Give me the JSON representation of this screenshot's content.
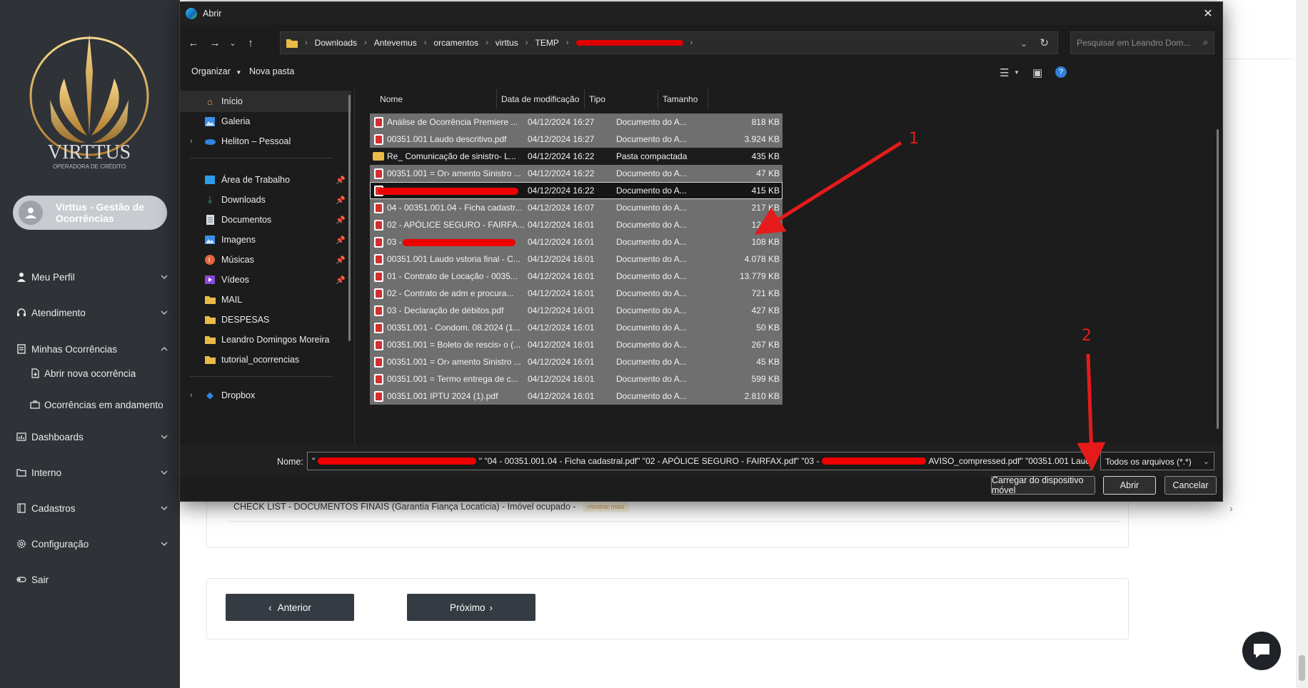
{
  "sidebar": {
    "logo_text": "VIRTTUS",
    "logo_sub": "OPERADORA DE CRÉDITO",
    "user_name": "Virttus - Gestão de Ocorrências",
    "menu": [
      {
        "label": "Meu Perfil",
        "icon": "user-icon"
      },
      {
        "label": "Atendimento",
        "icon": "headset-icon"
      },
      {
        "label": "Minhas Ocorrências",
        "icon": "list-icon"
      },
      {
        "label": "Dashboards",
        "icon": "dashboard-icon"
      },
      {
        "label": "Interno",
        "icon": "folder-icon"
      },
      {
        "label": "Cadastros",
        "icon": "book-icon"
      },
      {
        "label": "Configuração",
        "icon": "gear-icon"
      },
      {
        "label": "Sair",
        "icon": "toggle-icon"
      }
    ],
    "submenu": [
      {
        "label": "Abrir nova ocorrência",
        "icon": "new-file-icon"
      },
      {
        "label": "Ocorrências em andamento",
        "icon": "briefcase-icon"
      }
    ]
  },
  "main": {
    "checklist_label": "CHECK LIST - DOCUMENTOS FINAIS (Garantia Fiança Locatícia) - Imóvel ocupado -",
    "show_more": "mostrar mais",
    "prev_label": "Anterior",
    "next_label": "Próximo"
  },
  "dialog": {
    "title": "Abrir",
    "breadcrumb": [
      "Downloads",
      "Antevemus",
      "orcamentos",
      "virttus",
      "TEMP"
    ],
    "search_placeholder": "Pesquisar em Leandro Dom...",
    "toolbar": {
      "organize": "Organizar",
      "new_folder": "Nova pasta"
    },
    "nav_pane": [
      {
        "label": "Início",
        "icon": "home-icon"
      },
      {
        "label": "Galeria",
        "icon": "gallery-icon"
      },
      {
        "label": "Heliton – Pessoal",
        "icon": "cloud-icon"
      },
      {
        "label": "Área de Trabalho",
        "icon": "desktop-icon"
      },
      {
        "label": "Downloads",
        "icon": "download-icon"
      },
      {
        "label": "Documentos",
        "icon": "document-icon"
      },
      {
        "label": "Imagens",
        "icon": "image-icon"
      },
      {
        "label": "Músicas",
        "icon": "music-icon"
      },
      {
        "label": "Vídeos",
        "icon": "video-icon"
      },
      {
        "label": "MAIL",
        "icon": "folder-icon"
      },
      {
        "label": "DESPESAS",
        "icon": "folder-icon"
      },
      {
        "label": "Leandro Domingos Moreira",
        "icon": "folder-icon"
      },
      {
        "label": "tutorial_ocorrencias",
        "icon": "folder-icon"
      },
      {
        "label": "Dropbox",
        "icon": "dropbox-icon"
      }
    ],
    "columns": {
      "name": "Nome",
      "date": "Data de modificação",
      "type": "Tipo",
      "size": "Tamanho"
    },
    "files": [
      {
        "name": "Análise de Ocorrência Premiere ...",
        "date": "04/12/2024 16:27",
        "type": "Documento do A...",
        "size": "818 KB"
      },
      {
        "name": "00351.001 Laudo descritivo.pdf",
        "date": "04/12/2024 16:27",
        "type": "Documento do A...",
        "size": "3.924 KB"
      },
      {
        "name": "Re_ Comunicação de sinistro- L...",
        "date": "04/12/2024 16:22",
        "type": "Pasta compactada",
        "size": "435 KB"
      },
      {
        "name": "00351.001 = Or› amento Sinistro ...",
        "date": "04/12/2024 16:22",
        "type": "Documento do A...",
        "size": "47 KB"
      },
      {
        "name": "",
        "date": "04/12/2024 16:22",
        "type": "Documento do A...",
        "size": "415 KB"
      },
      {
        "name": "04 - 00351.001.04 - Ficha cadastr...",
        "date": "04/12/2024 16:07",
        "type": "Documento do A...",
        "size": "217 KB"
      },
      {
        "name": "02 - APÓLICE SEGURO - FAIRFA...",
        "date": "04/12/2024 16:01",
        "type": "Documento do A...",
        "size": "124 KB"
      },
      {
        "name": "03 -",
        "date": "04/12/2024 16:01",
        "type": "Documento do A...",
        "size": "108 KB"
      },
      {
        "name": "00351.001 Laudo vstoria final - C...",
        "date": "04/12/2024 16:01",
        "type": "Documento do A...",
        "size": "4.078 KB"
      },
      {
        "name": "01 - Contrato de Locação - 0035...",
        "date": "04/12/2024 16:01",
        "type": "Documento do A...",
        "size": "13.779 KB"
      },
      {
        "name": "02 - Contrato de adm e procura...",
        "date": "04/12/2024 16:01",
        "type": "Documento do A...",
        "size": "721 KB"
      },
      {
        "name": "03 - Declaração de débitos.pdf",
        "date": "04/12/2024 16:01",
        "type": "Documento do A...",
        "size": "427 KB"
      },
      {
        "name": "00351.001 - Condom. 08.2024 (1...",
        "date": "04/12/2024 16:01",
        "type": "Documento do A...",
        "size": "50 KB"
      },
      {
        "name": "00351.001 = Boleto de rescis› o (...",
        "date": "04/12/2024 16:01",
        "type": "Documento do A...",
        "size": "267 KB"
      },
      {
        "name": "00351.001 = Or› amento Sinistro ...",
        "date": "04/12/2024 16:01",
        "type": "Documento do A...",
        "size": "45 KB"
      },
      {
        "name": "00351.001 = Termo entrega de c...",
        "date": "04/12/2024 16:01",
        "type": "Documento do A...",
        "size": "599 KB"
      },
      {
        "name": "00351.001 IPTU 2024 (1).pdf",
        "date": "04/12/2024 16:01",
        "type": "Documento do A...",
        "size": "2.810 KB"
      }
    ],
    "name_label": "Nome:",
    "name_value_a": "\"",
    "name_value_b": "\" \"04 - 00351.001.04 - Ficha cadastral.pdf\" \"02 - APÓLICE SEGURO - FAIRFAX.pdf\" \"03 -",
    "name_value_c": "AVISO_compressed.pdf\" \"00351.001 Laud",
    "file_type": "Todos os arquivos (*.*)",
    "btn_device": "Carregar do dispositivo móvel",
    "btn_open": "Abrir",
    "btn_cancel": "Cancelar"
  },
  "annotations": {
    "one": "1",
    "two": "2"
  },
  "colors": {
    "sidebar_bg": "#2f3338",
    "dialog_bg": "#1c1c1c",
    "row_sel": "#6f6f6f",
    "annotation": "#e51b1b"
  }
}
